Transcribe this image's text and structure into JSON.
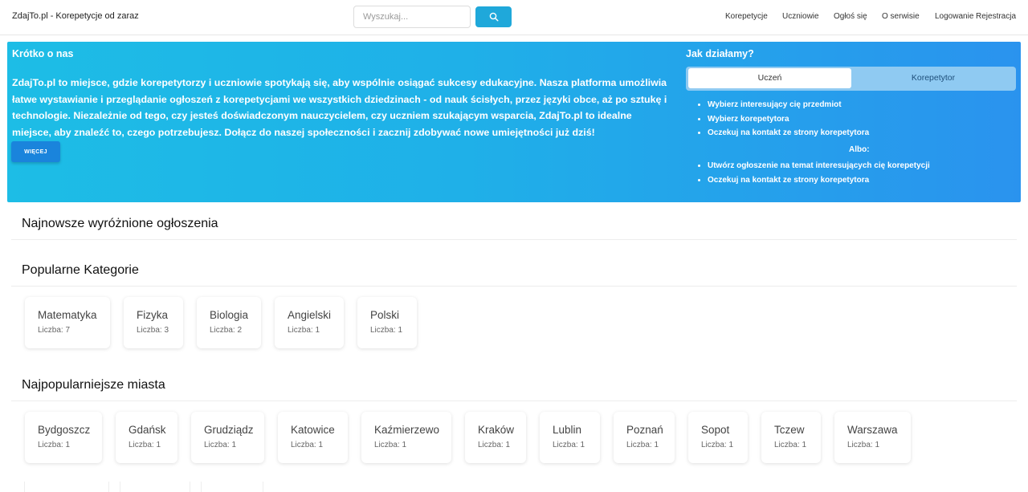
{
  "header": {
    "brand": "ZdajTo.pl - Korepetycje od zaraz",
    "search_placeholder": "Wyszukaj...",
    "nav": [
      "Korepetycje",
      "Uczniowie",
      "Ogłoś się",
      "O serwisie",
      "Logowanie",
      "Rejestracja"
    ]
  },
  "hero": {
    "about_title": "Krótko o nas",
    "about_text": "ZdajTo.pl to miejsce, gdzie korepetytorzy i uczniowie spotykają się, aby wspólnie osiągać sukcesy edukacyjne. Nasza platforma umożliwia łatwe wystawianie i przeglądanie ogłoszeń z korepetycjami we wszystkich dziedzinach - od nauk ścisłych, przez języki obce, aż po sztukę i technologie. Niezależnie od tego, czy jesteś doświadczonym nauczycielem, czy uczniem szukającym wsparcia, ZdajTo.pl to idealne miejsce, aby znaleźć to, czego potrzebujesz. Dołącz do naszej społeczności i zacznij zdobywać nowe umiejętności już dziś!",
    "more_label": "WIĘCEJ",
    "how_title": "Jak działamy?",
    "tabs": [
      "Uczeń",
      "Korepetytor"
    ],
    "active_tab": "Uczeń",
    "steps_a": [
      "Wybierz interesujący cię przedmiot",
      "Wybierz korepetytora",
      "Oczekuj na kontakt ze strony korepetytora"
    ],
    "or_label": "Albo:",
    "steps_b": [
      "Utwórz ogłoszenie na temat interesujących cię korepetycji",
      "Oczekuj na kontakt ze strony korepetytora"
    ]
  },
  "featured": {
    "title": "Najnowsze wyróżnione ogłoszenia"
  },
  "categories": {
    "title": "Popularne Kategorie",
    "items": [
      {
        "name": "Matematyka",
        "count": "Liczba: 7"
      },
      {
        "name": "Fizyka",
        "count": "Liczba: 3"
      },
      {
        "name": "Biologia",
        "count": "Liczba: 2"
      },
      {
        "name": "Angielski",
        "count": "Liczba: 1"
      },
      {
        "name": "Polski",
        "count": "Liczba: 1"
      }
    ]
  },
  "cities": {
    "title": "Najpopularniejsze miasta",
    "items": [
      {
        "name": "Bydgoszcz",
        "count": "Liczba: 1"
      },
      {
        "name": "Gdańsk",
        "count": "Liczba: 1"
      },
      {
        "name": "Grudziądz",
        "count": "Liczba: 1"
      },
      {
        "name": "Katowice",
        "count": "Liczba: 1"
      },
      {
        "name": "Kaźmierzewo",
        "count": "Liczba: 1"
      },
      {
        "name": "Kraków",
        "count": "Liczba: 1"
      },
      {
        "name": "Lublin",
        "count": "Liczba: 1"
      },
      {
        "name": "Poznań",
        "count": "Liczba: 1"
      },
      {
        "name": "Sopot",
        "count": "Liczba: 1"
      },
      {
        "name": "Tczew",
        "count": "Liczba: 1"
      },
      {
        "name": "Warszawa",
        "count": "Liczba: 1"
      }
    ]
  }
}
